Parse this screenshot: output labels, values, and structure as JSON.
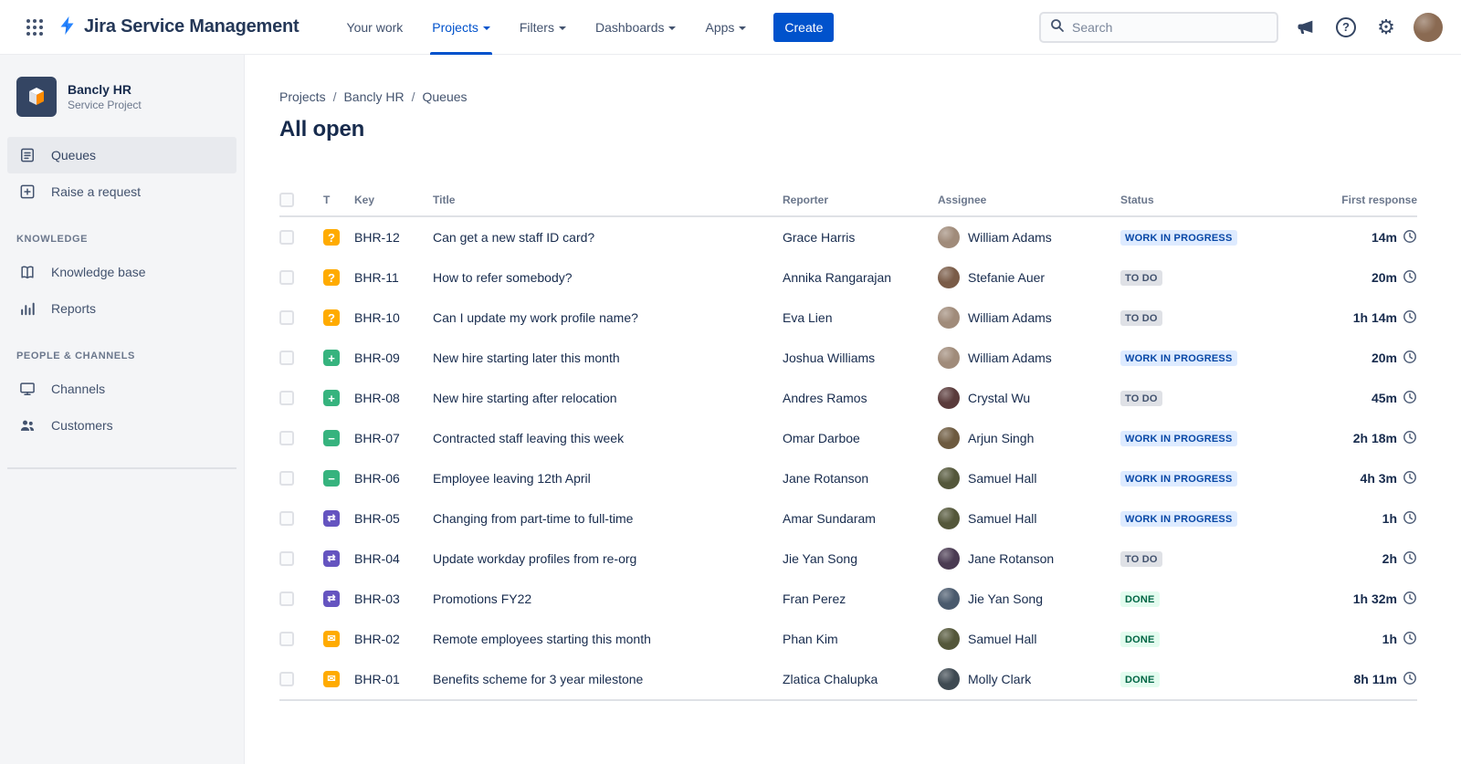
{
  "topbar": {
    "brand": "Jira Service Management",
    "nav_items": [
      {
        "label": "Your work",
        "dropdown": false,
        "active": false
      },
      {
        "label": "Projects",
        "dropdown": true,
        "active": true
      },
      {
        "label": "Filters",
        "dropdown": true,
        "active": false
      },
      {
        "label": "Dashboards",
        "dropdown": true,
        "active": false
      },
      {
        "label": "Apps",
        "dropdown": true,
        "active": false
      }
    ],
    "create_button": "Create",
    "search_placeholder": "Search",
    "help_glyph": "?",
    "icons": [
      "app-switcher-icon",
      "jira-logo-icon",
      "megaphone-icon",
      "help-icon",
      "settings-gear-icon",
      "user-avatar"
    ]
  },
  "sidebar": {
    "project_name": "Bancly HR",
    "project_subtitle": "Service Project",
    "primary_items": [
      {
        "label": "Queues",
        "icon": "queues-icon",
        "selected": true
      },
      {
        "label": "Raise a request",
        "icon": "raise-request-icon",
        "selected": false
      }
    ],
    "sections": [
      {
        "heading": "KNOWLEDGE",
        "items": [
          {
            "label": "Knowledge base",
            "icon": "book-icon"
          },
          {
            "label": "Reports",
            "icon": "bar-chart-icon"
          }
        ]
      },
      {
        "heading": "PEOPLE & CHANNELS",
        "items": [
          {
            "label": "Channels",
            "icon": "monitor-icon"
          },
          {
            "label": "Customers",
            "icon": "people-icon"
          }
        ]
      }
    ]
  },
  "main": {
    "breadcrumb": [
      "Projects",
      "Bancly HR",
      "Queues"
    ],
    "page_title": "All open",
    "table": {
      "headers": {
        "type": "T",
        "key": "Key",
        "title": "Title",
        "reporter": "Reporter",
        "assignee": "Assignee",
        "status": "Status",
        "first_response": "First response"
      },
      "type_icons": {
        "question": {
          "glyph": "?",
          "color": "#FFAB00",
          "name": "question-type-icon"
        },
        "add": {
          "glyph": "+",
          "color": "#36B37E",
          "name": "new-hire-type-icon"
        },
        "remove": {
          "glyph": "−",
          "color": "#36B37E",
          "name": "leaver-type-icon"
        },
        "change": {
          "glyph": "⇄",
          "color": "#6554C0",
          "name": "change-type-icon"
        },
        "email": {
          "glyph": "✉",
          "color": "#FFAB00",
          "name": "email-type-icon"
        }
      },
      "rows": [
        {
          "type": "question",
          "key": "BHR-12",
          "title": "Can get a new staff ID card?",
          "reporter": "Grace Harris",
          "assignee": "William Adams",
          "avatar_color": "#a08b7a",
          "status": "WORK IN PROGRESS",
          "status_kind": "inprogress",
          "first_response": "14m"
        },
        {
          "type": "question",
          "key": "BHR-11",
          "title": "How to refer somebody?",
          "reporter": "Annika Rangarajan",
          "assignee": "Stefanie Auer",
          "avatar_color": "#7a5c48",
          "status": "TO DO",
          "status_kind": "todo",
          "first_response": "20m"
        },
        {
          "type": "question",
          "key": "BHR-10",
          "title": "Can I update my work profile name?",
          "reporter": "Eva Lien",
          "assignee": "William Adams",
          "avatar_color": "#a08b7a",
          "status": "TO DO",
          "status_kind": "todo",
          "first_response": "1h 14m"
        },
        {
          "type": "add",
          "key": "BHR-09",
          "title": "New hire starting later this month",
          "reporter": "Joshua Williams",
          "assignee": "William Adams",
          "avatar_color": "#a08b7a",
          "status": "WORK IN PROGRESS",
          "status_kind": "inprogress",
          "first_response": "20m"
        },
        {
          "type": "add",
          "key": "BHR-08",
          "title": "New hire starting after relocation",
          "reporter": "Andres Ramos",
          "assignee": "Crystal Wu",
          "avatar_color": "#5a3b3b",
          "status": "TO DO",
          "status_kind": "todo",
          "first_response": "45m"
        },
        {
          "type": "remove",
          "key": "BHR-07",
          "title": "Contracted staff leaving this week",
          "reporter": "Omar Darboe",
          "assignee": "Arjun Singh",
          "avatar_color": "#6d5a3f",
          "status": "WORK IN PROGRESS",
          "status_kind": "inprogress",
          "first_response": "2h 18m"
        },
        {
          "type": "remove",
          "key": "BHR-06",
          "title": "Employee leaving 12th April",
          "reporter": "Jane Rotanson",
          "assignee": "Samuel Hall",
          "avatar_color": "#54573a",
          "status": "WORK IN PROGRESS",
          "status_kind": "inprogress",
          "first_response": "4h 3m"
        },
        {
          "type": "change",
          "key": "BHR-05",
          "title": "Changing from part-time to full-time",
          "reporter": "Amar Sundaram",
          "assignee": "Samuel Hall",
          "avatar_color": "#54573a",
          "status": "WORK IN PROGRESS",
          "status_kind": "inprogress",
          "first_response": "1h"
        },
        {
          "type": "change",
          "key": "BHR-04",
          "title": "Update workday profiles from re-org",
          "reporter": "Jie Yan Song",
          "assignee": "Jane Rotanson",
          "avatar_color": "#4a3b52",
          "status": "TO DO",
          "status_kind": "todo",
          "first_response": "2h"
        },
        {
          "type": "change",
          "key": "BHR-03",
          "title": "Promotions FY22",
          "reporter": "Fran Perez",
          "assignee": "Jie Yan Song",
          "avatar_color": "#4a5a6d",
          "status": "DONE",
          "status_kind": "done",
          "first_response": "1h 32m"
        },
        {
          "type": "email",
          "key": "BHR-02",
          "title": "Remote employees starting this month",
          "reporter": "Phan Kim",
          "assignee": "Samuel Hall",
          "avatar_color": "#54573a",
          "status": "DONE",
          "status_kind": "done",
          "first_response": "1h"
        },
        {
          "type": "email",
          "key": "BHR-01",
          "title": "Benefits scheme for 3 year milestone",
          "reporter": "Zlatica Chalupka",
          "assignee": "Molly Clark",
          "avatar_color": "#3f4a52",
          "status": "DONE",
          "status_kind": "done",
          "first_response": "8h 11m"
        }
      ]
    }
  }
}
